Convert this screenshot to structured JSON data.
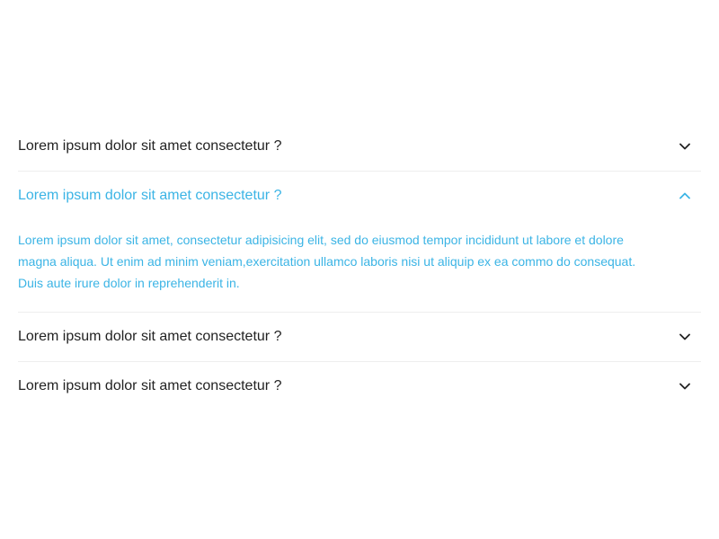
{
  "faq": {
    "items": [
      {
        "question": "Lorem ipsum dolor sit amet consectetur ?",
        "expanded": false,
        "icon": "chevron-down-icon"
      },
      {
        "question": "Lorem ipsum dolor sit amet consectetur ?",
        "expanded": true,
        "icon": "chevron-up-icon",
        "answer": "Lorem ipsum dolor sit amet, consectetur adipisicing elit, sed do eiusmod tempor incididunt ut labore et dolore magna aliqua. Ut enim ad minim veniam,exercitation ullamco laboris nisi ut aliquip ex ea commo do consequat. Duis aute irure dolor in reprehenderit in."
      },
      {
        "question": "Lorem ipsum dolor sit amet consectetur ?",
        "expanded": false,
        "icon": "chevron-down-icon"
      },
      {
        "question": "Lorem ipsum dolor sit amet consectetur ?",
        "expanded": false,
        "icon": "chevron-down-icon"
      }
    ]
  },
  "colors": {
    "accent": "#3bb4e5",
    "text": "#222222",
    "divider": "#eeeeee"
  }
}
